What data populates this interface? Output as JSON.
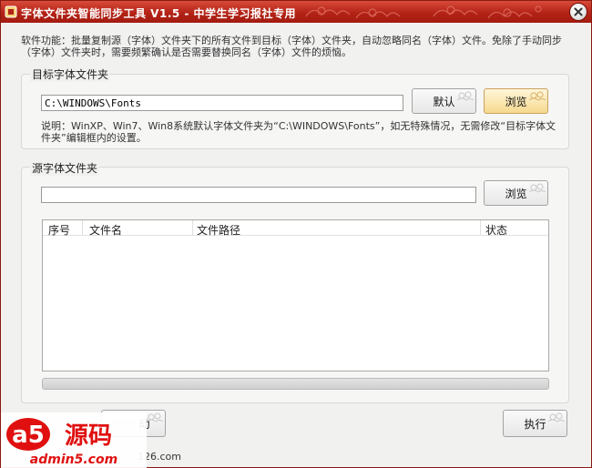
{
  "window": {
    "title": "字体文件夹智能同步工具 V1.5 - 中学生学习报社专用"
  },
  "description": "软件功能：批量复制源（字体）文件夹下的所有文件到目标（字体）文件夹，自动忽略同名（字体）文件。免除了手动同步（字体）文件夹时，需要频繁确认是否需要替换同名（字体）文件的烦恼。",
  "target_group": {
    "label": "目标字体文件夹",
    "path_value": "C:\\WINDOWS\\Fonts",
    "default_button": "默认",
    "browse_button": "浏览",
    "note": "说明：WinXP、Win7、Win8系统默认字体文件夹为“C:\\WINDOWS\\Fonts”，如无特殊情况，无需修改“目标字体文件夹”编辑框内的设置。"
  },
  "source_group": {
    "label": "源字体文件夹",
    "path_value": "",
    "browse_button": "浏览",
    "columns": [
      "序号",
      "文件名",
      "文件路径",
      "状态"
    ],
    "rows": [],
    "progress": 0
  },
  "bottom": {
    "middle_button_partial": "动",
    "execute_button": "执行",
    "footer_partial": "126.com"
  },
  "watermark": {
    "main": "a5源码",
    "sub": "admin5.com"
  },
  "colors": {
    "titlebar": "#b32316",
    "hot_button": "#f6d98f",
    "watermark_red": "#e01010"
  }
}
